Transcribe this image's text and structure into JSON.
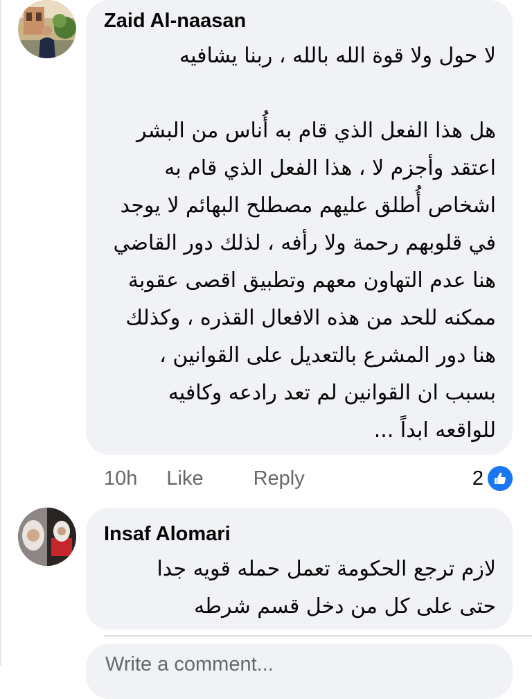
{
  "comments": [
    {
      "author": "Zaid Al-naasan",
      "lines": [
        "لا حول ولا قوة الله بالله ، ربنا يشافيه",
        "",
        "هل هذا الفعل الذي قام به أُناس من البشر",
        "اعتقد وأجزم لا ، هذا الفعل الذي قام به",
        "اشخاص أُطلق عليهم مصطلح البهائم لا يوجد",
        "في قلوبهم رحمة ولا رأفه ، لذلك دور القاضي",
        "هنا عدم التهاون معهم وتطبيق اقصى عقوبة",
        "ممكنه للحد من هذه الافعال القذره ، وكذلك",
        "هنا دور المشرع بالتعديل على القوانين ،",
        "بسبب ان القوانين لم تعد رادعه وكافيه",
        "للواقعه ابداً ..."
      ],
      "time": "10h",
      "like_label": "Like",
      "reply_label": "Reply",
      "reaction_count": "2",
      "reaction_icon": "like-thumb-icon"
    },
    {
      "author": "Insaf Alomari",
      "lines": [
        "لازم ترجع الحكومة تعمل حمله قويه جدا",
        "حتى على كل من دخل قسم شرطه"
      ]
    }
  ],
  "composer": {
    "placeholder": "Write a comment..."
  },
  "colors": {
    "bubble": "#f0f2f5",
    "secondary_text": "#65676b",
    "like_blue": "#1877f2"
  }
}
